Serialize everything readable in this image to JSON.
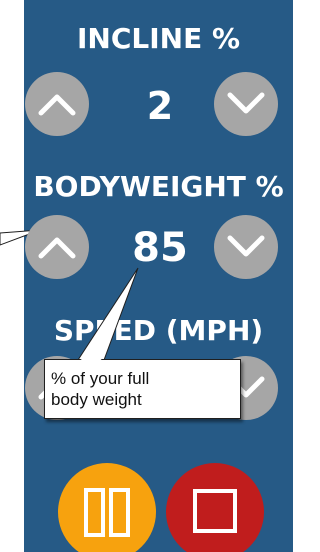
{
  "incline": {
    "label": "INCLINE %",
    "value": "2"
  },
  "bodyweight": {
    "label": "BODYWEIGHT %",
    "value": "85"
  },
  "speed": {
    "label": "SPEED (MPH)"
  },
  "tooltip": {
    "line1": "% of your full",
    "line2": "body weight"
  },
  "colors": {
    "panel": "#265a86",
    "button_gray": "#a6a6a6",
    "pause": "#f7a20e",
    "stop": "#c01d1d"
  },
  "icons": {
    "up": "chevron-up-icon",
    "down": "chevron-down-icon",
    "pause": "pause-icon",
    "stop": "stop-icon"
  }
}
